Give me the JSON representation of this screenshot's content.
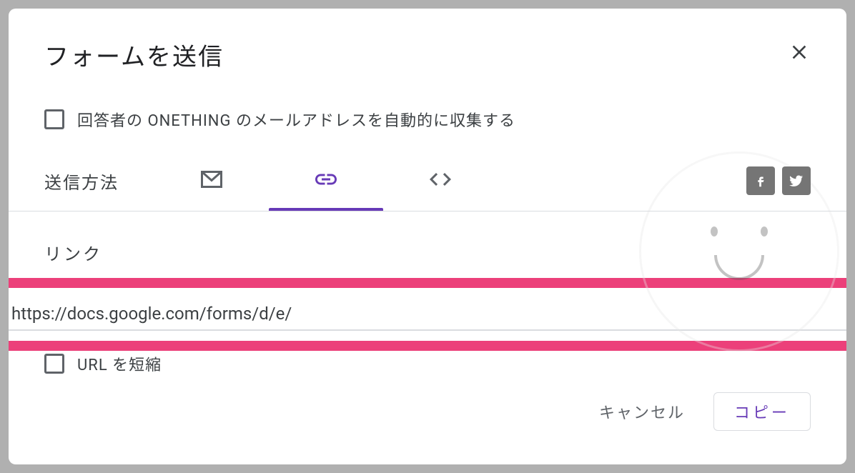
{
  "dialog": {
    "title": "フォームを送信",
    "collect_label": "回答者の ONETHING のメールアドレスを自動的に収集する",
    "send_method_label": "送信方法",
    "link_label": "リンク",
    "link_value": "https://docs.google.com/forms/d/e/",
    "shorten_label": "URL を短縮",
    "cancel_label": "キャンセル",
    "copy_label": "コピー"
  },
  "colors": {
    "accent": "#673ab7",
    "highlight": "#ec407a"
  }
}
